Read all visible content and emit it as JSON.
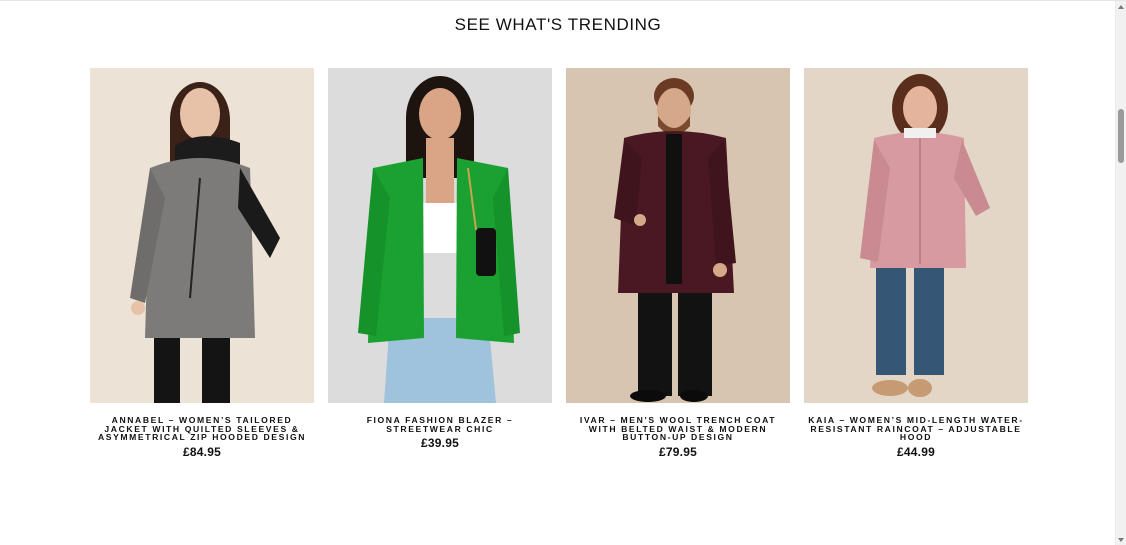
{
  "section": {
    "title": "SEE WHAT'S TRENDING"
  },
  "products": [
    {
      "title": "Annabel – Women’s Tailored Jacket with Quilted Sleeves & Asymmetrical Zip Hooded Design",
      "price": "£84.95",
      "image": "woman-grey-tweed-hooded-jacket"
    },
    {
      "title": "Fiona Fashion Blazer – Streetwear Chic",
      "price": "£39.95",
      "image": "woman-green-blazer"
    },
    {
      "title": "Ivar – Men’s Wool Trench Coat with Belted Waist & Modern Button-Up Design",
      "price": "£79.95",
      "image": "man-burgundy-wool-coat"
    },
    {
      "title": "Kaia – Women’s Mid-Length Water-Resistant Raincoat – Adjustable Hood",
      "price": "£44.99",
      "image": "woman-pink-raincoat"
    }
  ],
  "colors": {
    "text": "#111111",
    "background": "#ffffff"
  }
}
